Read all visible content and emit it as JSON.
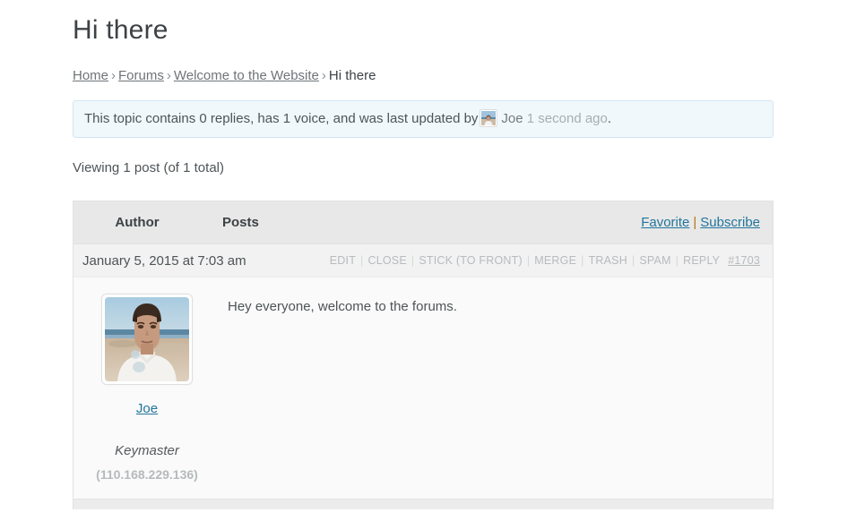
{
  "page": {
    "title": "Hi there"
  },
  "breadcrumb": {
    "separator": "›",
    "items": [
      {
        "label": "Home",
        "link": true
      },
      {
        "label": "Forums",
        "link": true
      },
      {
        "label": "Welcome to the Website",
        "link": true
      },
      {
        "label": "Hi there",
        "link": false
      }
    ]
  },
  "notice": {
    "text_before": "This topic contains 0 replies, has 1 voice, and was last updated by",
    "author": "Joe",
    "time_ago": "1 second ago",
    "trailing": ".",
    "avatar_name": "user-avatar-thumbnail",
    "border_color": "#d3e5f0",
    "background_color": "#f0f8fc"
  },
  "viewing": {
    "text": "Viewing 1 post (of 1 total)"
  },
  "topic_table": {
    "header": {
      "author_label": "Author",
      "posts_label": "Posts",
      "favorite_label": "Favorite",
      "separator": "|",
      "subscribe_label": "Subscribe",
      "background_color": "#e8e8e8",
      "link_color": "#21759b"
    },
    "post": {
      "date": "January 5, 2015 at 7:03 am",
      "admin_links": [
        "EDIT",
        "CLOSE",
        "STICK (TO FRONT)",
        "MERGE",
        "TRASH",
        "SPAM",
        "REPLY"
      ],
      "admin_divider": "|",
      "permalink": "#1703",
      "author": {
        "name": "Joe",
        "role": "Keymaster",
        "ip": "(110.168.229.136)",
        "avatar_name": "user-avatar-large"
      },
      "content": "Hey everyone, welcome to the forums."
    }
  }
}
